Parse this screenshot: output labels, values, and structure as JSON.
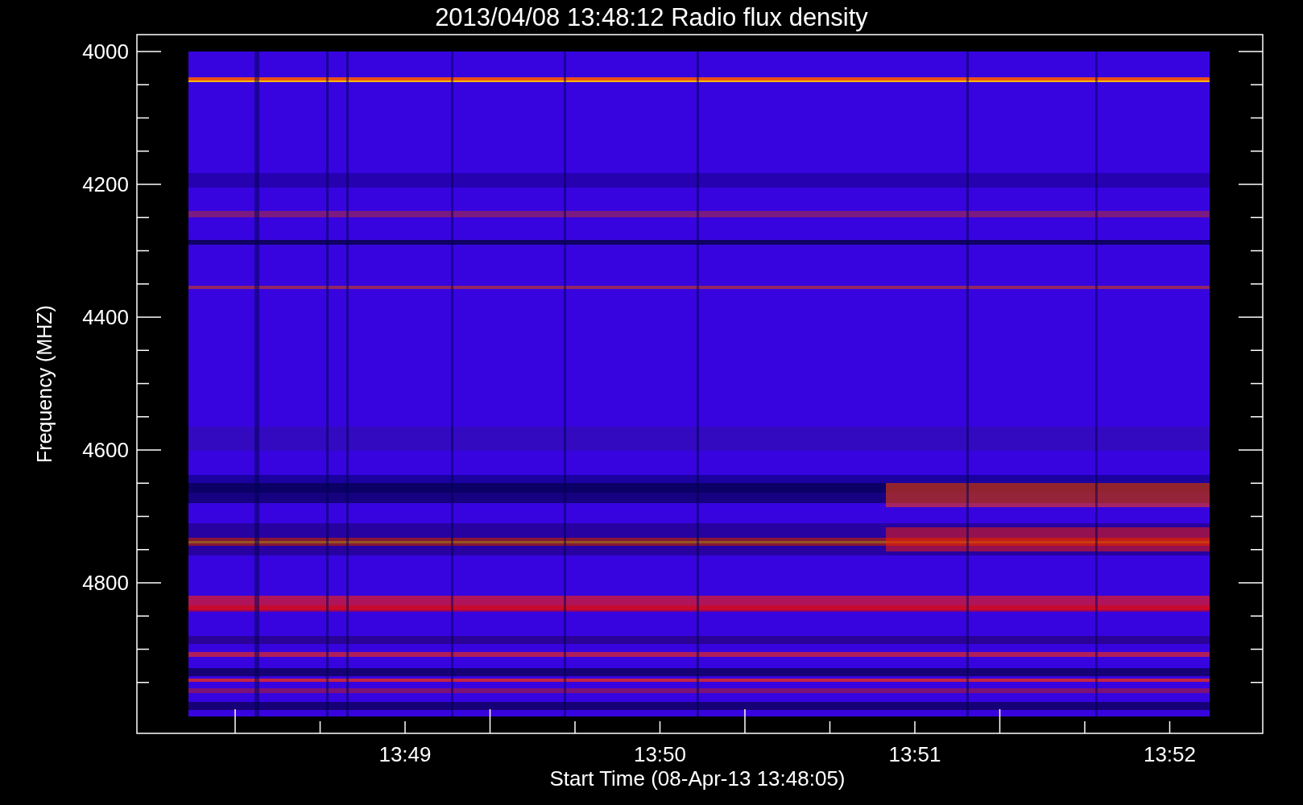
{
  "title": "2013/04/08 13:48:12 Radio flux density",
  "y_axis": {
    "label": "Frequency (MHZ)",
    "ticks": [
      "4000",
      "4200",
      "4400",
      "4600",
      "4800"
    ]
  },
  "x_axis": {
    "label": "Start Time (08-Apr-13 13:48:05)",
    "ticks": [
      "13:49",
      "13:50",
      "13:51",
      "13:52"
    ]
  }
}
